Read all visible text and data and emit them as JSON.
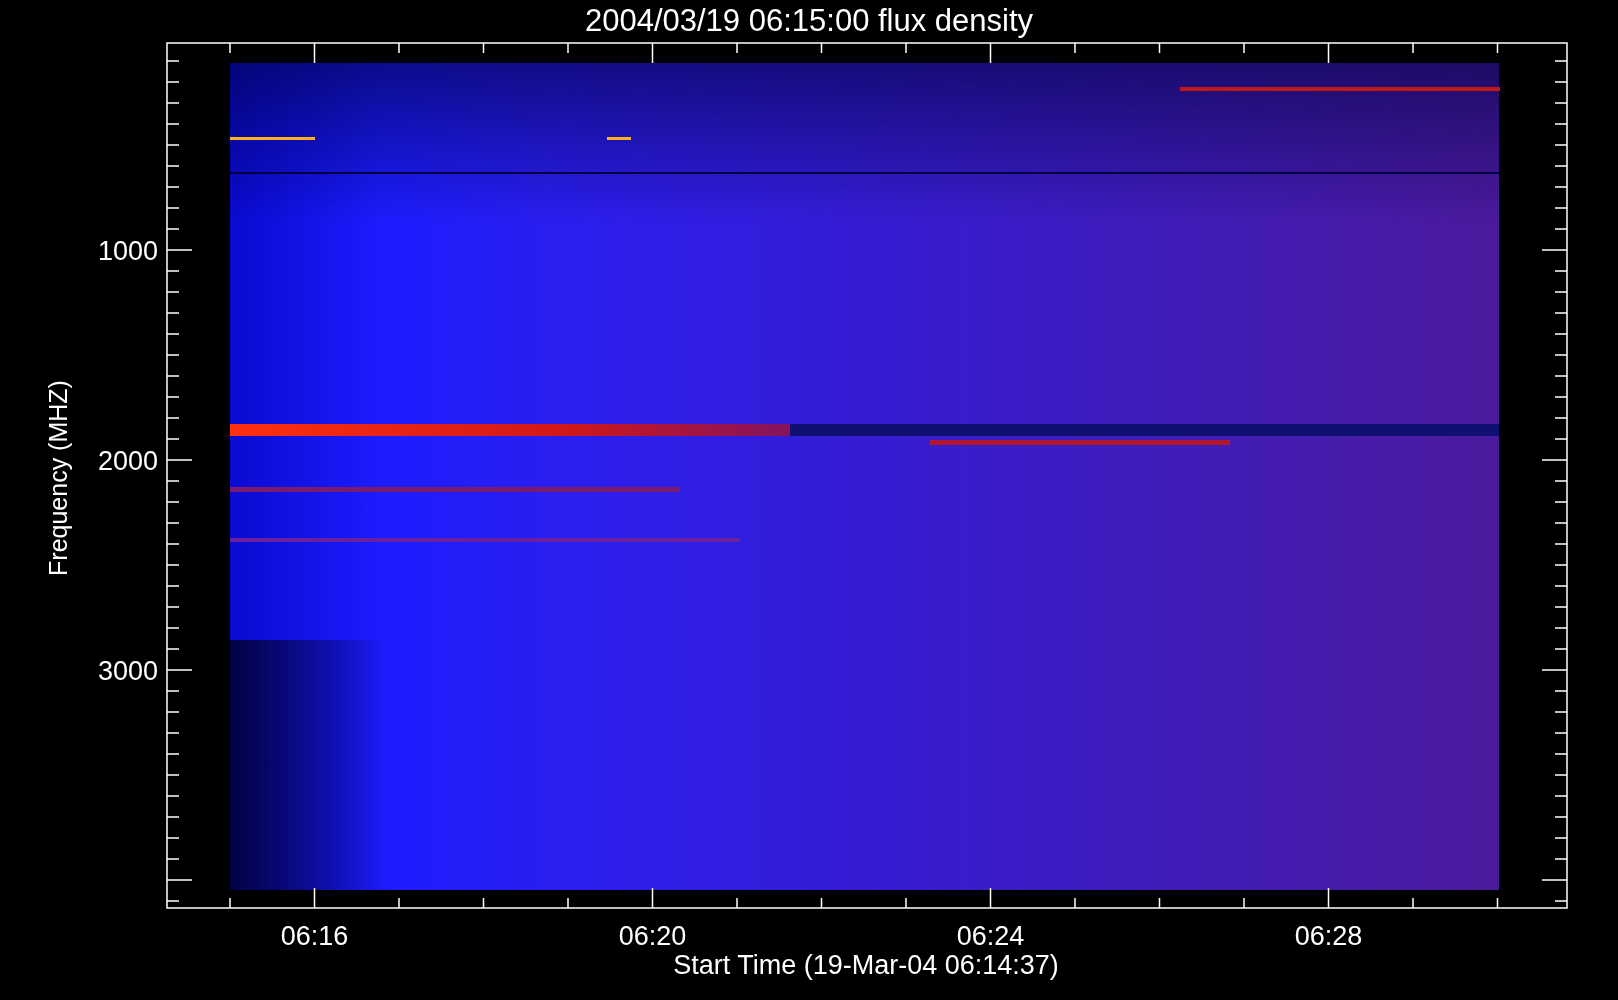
{
  "title": "2004/03/19 06:15:00 flux density",
  "y_axis": {
    "label": "Frequency (MHZ)",
    "tick_labels": [
      "1000",
      "2000",
      "3000"
    ]
  },
  "x_axis": {
    "label": "Start Time (19-Mar-04 06:14:37)",
    "tick_labels": [
      "06:16",
      "06:20",
      "06:24",
      "06:28"
    ]
  }
}
